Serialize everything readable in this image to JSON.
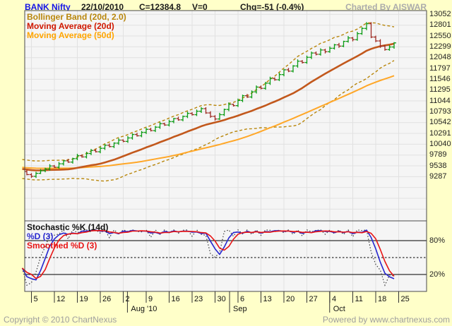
{
  "header": {
    "symbol": "BANK Nifty",
    "date": "22/10/2010",
    "close": "C=12384.8",
    "volume": "V=0",
    "change": "Chg=-51 (-0.4%)",
    "charted_by": "Charted By AISWAR"
  },
  "main_panel": {
    "legend": [
      "Bollinger Band (20d, 2.0)",
      "Moving Average (20d)",
      "Moving Average (50d)"
    ],
    "y_labels": [
      "13052",
      "12801",
      "12550",
      "12299",
      "12048",
      "11797",
      "11546",
      "11295",
      "11044",
      "10793",
      "10542",
      "10291",
      "10040",
      "9789",
      "9538",
      "9287"
    ]
  },
  "stoch_panel": {
    "legend": [
      "Stochastic %K (14d)",
      "%D (3)",
      "Smoothed %D (3)"
    ],
    "level_labels": [
      {
        "text": "80%",
        "value": 80
      },
      {
        "text": "20%",
        "value": 20
      }
    ]
  },
  "x_axis": {
    "ticks": [
      "5",
      "12",
      "19",
      "26",
      "2",
      "9",
      "16",
      "23",
      "30",
      "6",
      "13",
      "20",
      "27",
      "4",
      "11",
      "18",
      "25"
    ],
    "months": [
      {
        "label": "Aug '10",
        "week": 4.09
      },
      {
        "label": "Sep",
        "week": 8.54
      },
      {
        "label": "Oct",
        "week": 12.9
      }
    ]
  },
  "footer": {
    "copyright": "Copyright © 2010 ChartNexus",
    "powered": "Powered by www.chartnexus.com"
  },
  "colors": {
    "page_bg": "#FFFFC9",
    "panel_bg": "#F5F5F5",
    "grid": "#E1E1E1",
    "border": "#4A4A4A",
    "candle_up": "#0B9B14",
    "candle_down": "#9E2B22",
    "ma20": "#C2581C",
    "ma50": "#FFA728",
    "bollinger": "#B8860B",
    "stoch_k": "#3A3A3A",
    "stoch_d": "#2727CF",
    "stoch_sd": "#E81414",
    "level_line": "#000000",
    "symbol_blue": "#1414E6",
    "muted_gray": "#ABABAB"
  },
  "chart_data": {
    "type": "candlestick",
    "title": "BANK Nifty",
    "as_of_date": "22/10/2010",
    "last_close": 12384.8,
    "change": "-51 (-0.4%)",
    "ylim": [
      8257,
      13134
    ],
    "y_ticks": [
      13052,
      12801,
      12550,
      12299,
      12048,
      11797,
      11546,
      11295,
      11044,
      10793,
      10542,
      10291,
      10040,
      9789,
      9538,
      9287
    ],
    "x_week_ticks": [
      "5",
      "12",
      "19",
      "26",
      "2",
      "9",
      "16",
      "23",
      "30",
      "6",
      "13",
      "20",
      "27",
      "4",
      "11",
      "18",
      "25"
    ],
    "month_markers": [
      "Aug '10",
      "Sep",
      "Oct"
    ],
    "indicators": {
      "bollinger_band": "20d, 2.0",
      "moving_average_1": "20d",
      "moving_average_2": "50d",
      "stochastic": {
        "k": "14d",
        "d": "3",
        "smoothed_d": "3",
        "levels": [
          80,
          50,
          20
        ]
      }
    },
    "closes": [
      9400,
      9330,
      9290,
      9360,
      9420,
      9460,
      9530,
      9500,
      9580,
      9650,
      9620,
      9700,
      9770,
      9740,
      9820,
      9890,
      9860,
      9940,
      10010,
      9980,
      10060,
      10130,
      10100,
      10180,
      10260,
      10230,
      10310,
      10380,
      10350,
      10430,
      10510,
      10480,
      10560,
      10630,
      10600,
      10680,
      10750,
      10720,
      10800,
      10860,
      10760,
      10680,
      10620,
      10720,
      10840,
      10960,
      10930,
      11050,
      11160,
      11130,
      11250,
      11360,
      11330,
      11450,
      11560,
      11530,
      11650,
      11760,
      11730,
      11850,
      11960,
      11930,
      12050,
      12150,
      12120,
      12220,
      12180,
      12260,
      12340,
      12310,
      12420,
      12500,
      12460,
      12600,
      12720,
      12830,
      12520,
      12430,
      12310,
      12230,
      12290,
      12384.8
    ]
  }
}
